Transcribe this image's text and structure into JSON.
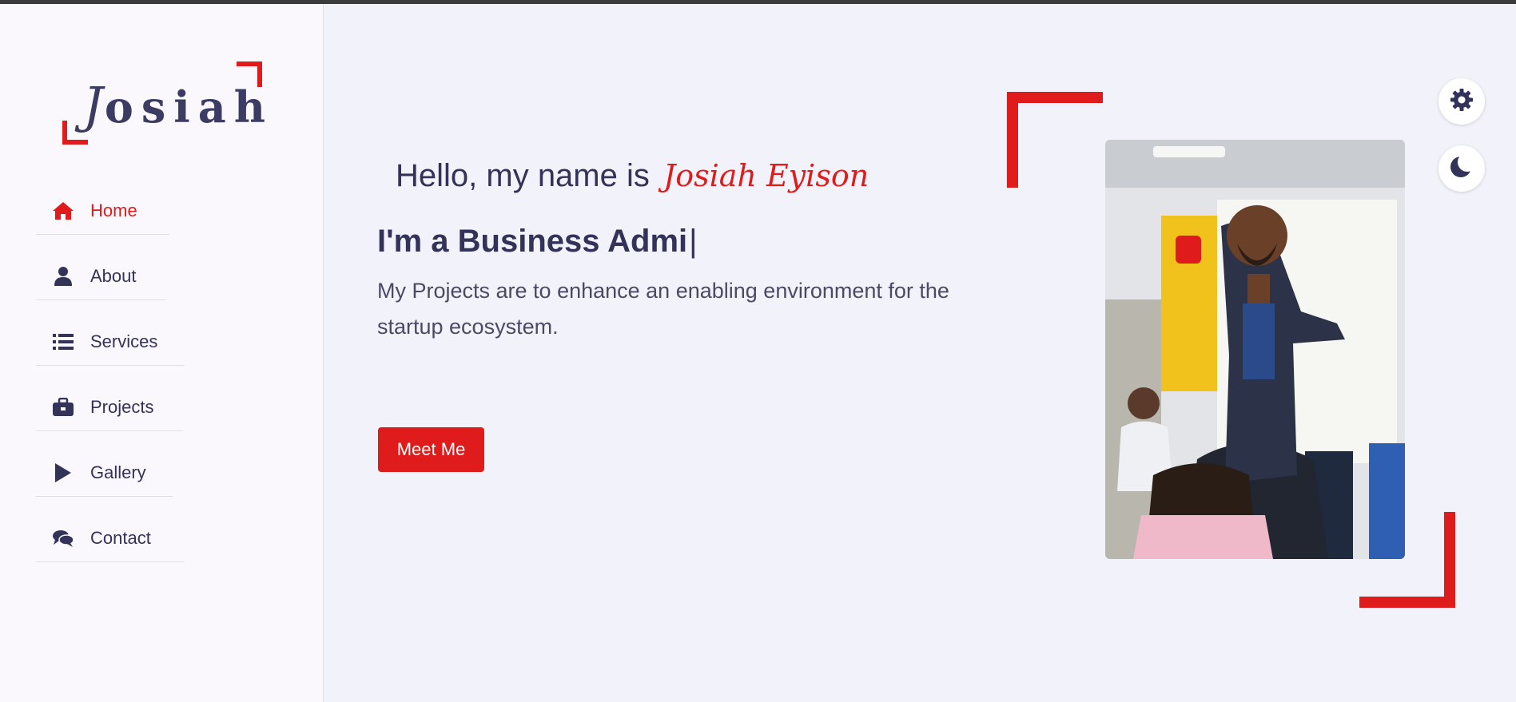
{
  "logo": {
    "first_letter": "J",
    "rest": "osiah"
  },
  "nav": {
    "items": [
      {
        "label": "Home",
        "icon": "home-icon",
        "active": true
      },
      {
        "label": "About",
        "icon": "user-icon",
        "active": false
      },
      {
        "label": "Services",
        "icon": "list-icon",
        "active": false
      },
      {
        "label": "Projects",
        "icon": "briefcase-icon",
        "active": false
      },
      {
        "label": "Gallery",
        "icon": "play-icon",
        "active": false
      },
      {
        "label": "Contact",
        "icon": "comments-icon",
        "active": false
      }
    ]
  },
  "hero": {
    "greeting": "Hello, my name is",
    "name": "Josiah Eyison",
    "typed_text": "I'm a Business Admi",
    "cursor": "|",
    "description": "My Projects are to enhance an enabling environment for the startup ecosystem.",
    "cta_label": "Meet Me"
  },
  "controls": {
    "settings_icon": "gear-icon",
    "theme_icon": "moon-icon"
  },
  "colors": {
    "accent": "#e01b1b",
    "text": "#33335a",
    "background": "#f2f3fa",
    "sidebar": "#fbf8fd"
  }
}
